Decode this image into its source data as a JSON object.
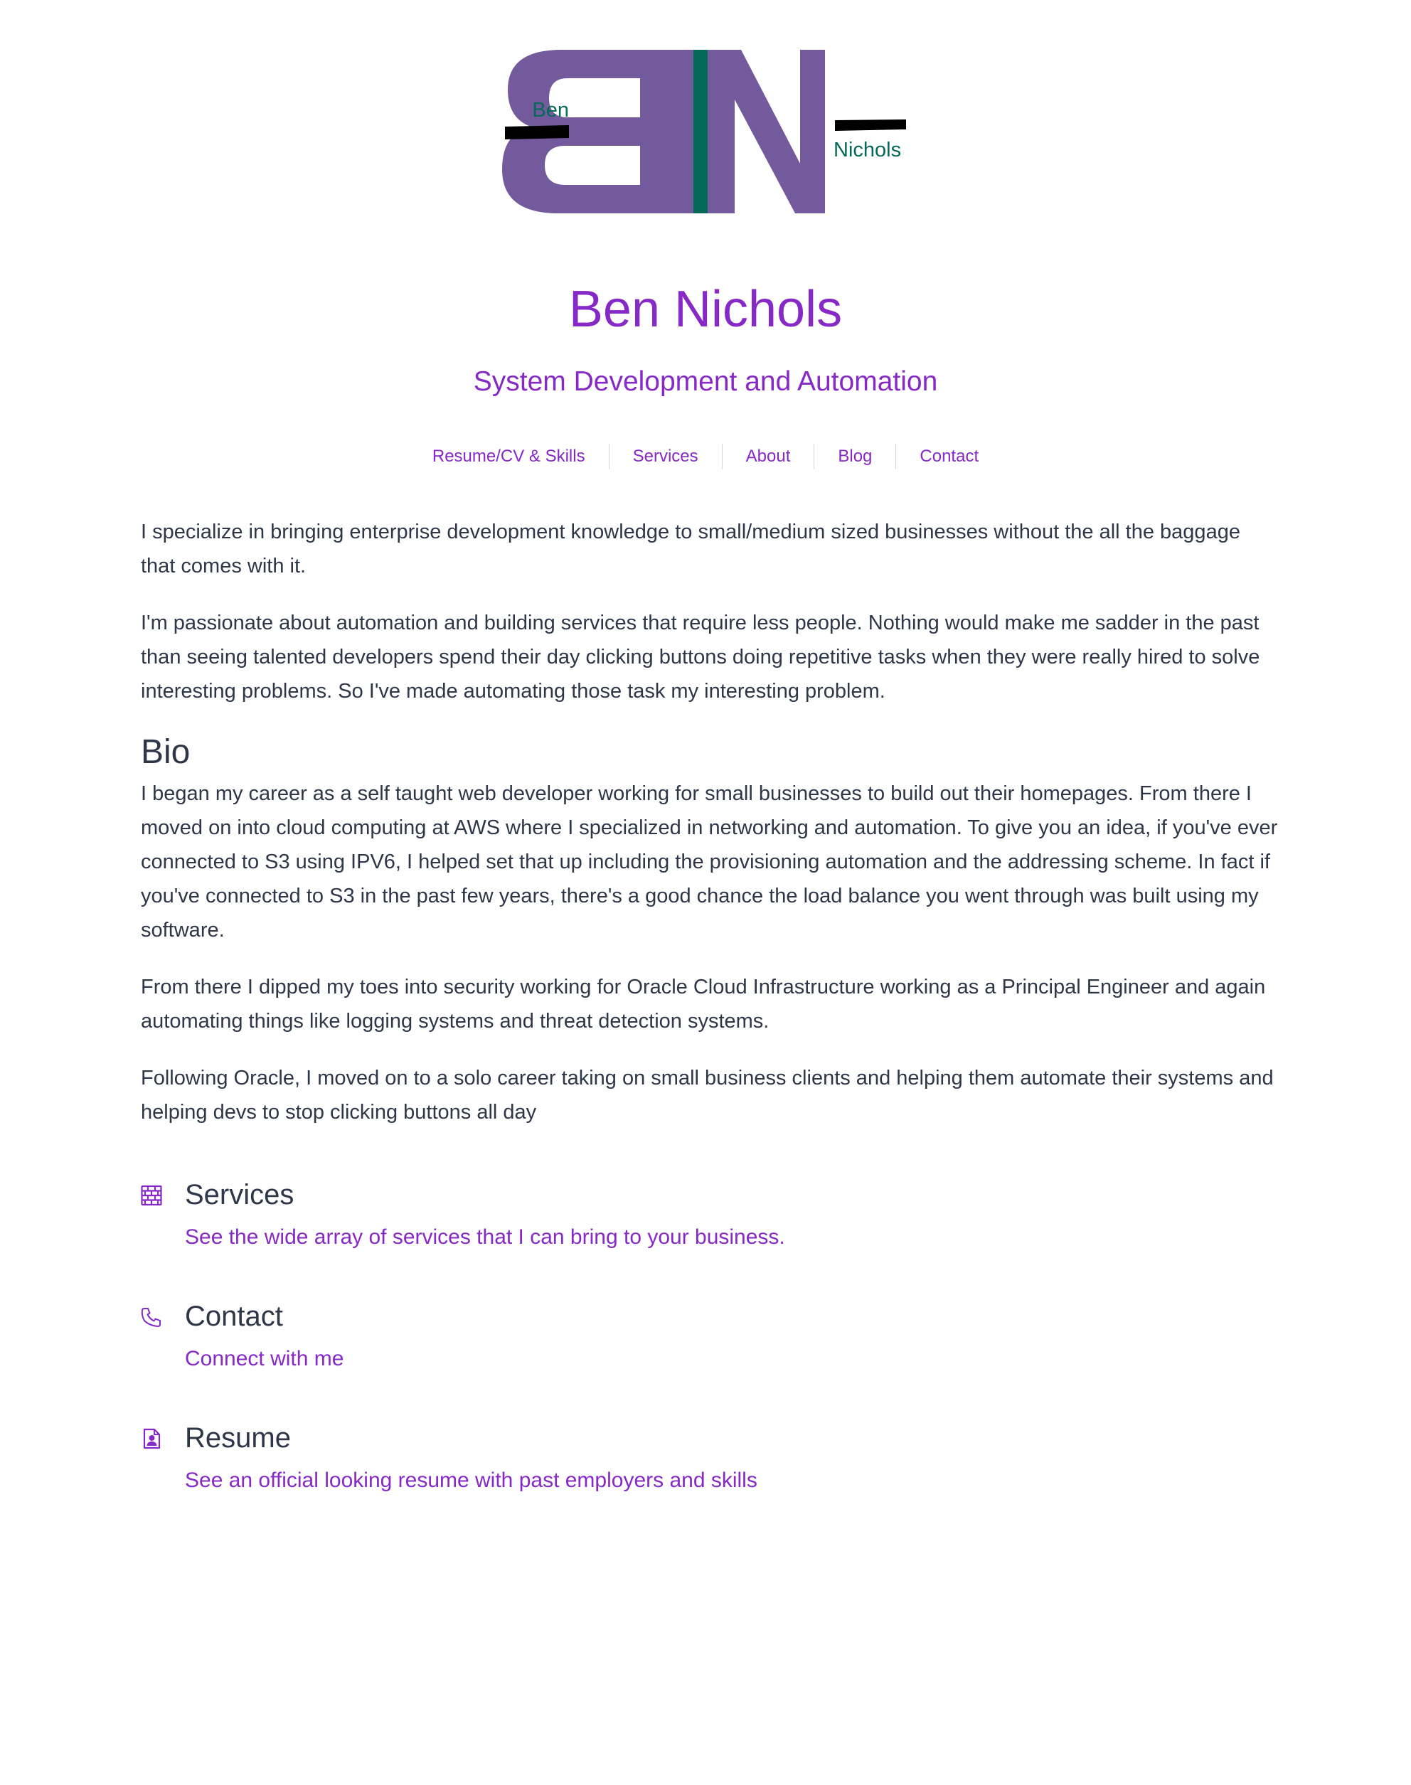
{
  "logo": {
    "first_name": "Ben",
    "last_name": "Nichols",
    "colors": {
      "letters": "#735a9c",
      "stripe": "#046a57",
      "bars": "#000000",
      "text": "#046a57"
    }
  },
  "header": {
    "title": "Ben Nichols",
    "subtitle": "System Development and Automation"
  },
  "nav": {
    "items": [
      {
        "label": "Resume/CV & Skills"
      },
      {
        "label": "Services"
      },
      {
        "label": "About"
      },
      {
        "label": "Blog"
      },
      {
        "label": "Contact"
      }
    ]
  },
  "intro": {
    "paragraphs": [
      "I specialize in bringing enterprise development knowledge to small/medium sized businesses without the all the baggage that comes with it.",
      "I'm passionate about automation and building services that require less people. Nothing would make me sadder in the past than seeing talented developers spend their day clicking buttons doing repetitive tasks when they were really hired to solve interesting problems. So I've made automating those task my interesting problem."
    ]
  },
  "bio": {
    "heading": "Bio",
    "paragraphs": [
      "I began my career as a self taught web developer working for small businesses to build out their homepages. From there I moved on into cloud computing at AWS where I specialized in networking and automation. To give you an idea, if you've ever connected to S3 using IPV6, I helped set that up including the provisioning automation and the addressing scheme. In fact if you've connected to S3 in the past few years, there's a good chance the load balance you went through was built using my software.",
      "From there I dipped my toes into security working for Oracle Cloud Infrastructure working as a Principal Engineer and again automating things like logging systems and threat detection systems.",
      "Following Oracle, I moved on to a solo career taking on small business clients and helping them automate their systems and helping devs to stop clicking buttons all day"
    ]
  },
  "features": [
    {
      "icon": "brick-wall-icon",
      "title": "Services",
      "link": "See the wide array of services that I can bring to your business."
    },
    {
      "icon": "phone-icon",
      "title": "Contact",
      "link": "Connect with me"
    },
    {
      "icon": "resume-icon",
      "title": "Resume",
      "link": "See an official looking resume with past employers and skills"
    }
  ],
  "colors": {
    "accent": "#8629c6",
    "text": "#2d3748",
    "nav_separator": "#d4d8de"
  }
}
